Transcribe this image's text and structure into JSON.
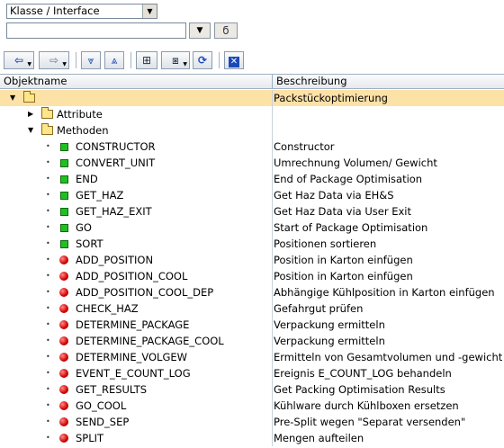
{
  "toolbar": {
    "type_select": "Klasse / Interface",
    "object_value": "",
    "icons": [
      "back-icon",
      "forward-icon",
      "collapse-all-icon",
      "expand-all-icon",
      "hierarchy-icon",
      "display-object-icon",
      "refresh-icon",
      "close-icon"
    ]
  },
  "table": {
    "col_name": "Objektname",
    "col_desc": "Beschreibung"
  },
  "tree": {
    "root": {
      "name": "",
      "desc": "Packstückoptimierung"
    },
    "attribute": {
      "name": "Attribute",
      "desc": ""
    },
    "methoden": {
      "name": "Methoden",
      "desc": ""
    },
    "methods": [
      {
        "name": "CONSTRUCTOR",
        "desc": "Constructor",
        "status": "green"
      },
      {
        "name": "CONVERT_UNIT",
        "desc": "Umrechnung Volumen/ Gewicht",
        "status": "green"
      },
      {
        "name": "END",
        "desc": "End of  Package Optimisation",
        "status": "green"
      },
      {
        "name": "GET_HAZ",
        "desc": "Get Haz Data via EH&S",
        "status": "green"
      },
      {
        "name": "GET_HAZ_EXIT",
        "desc": "Get Haz Data via User Exit",
        "status": "green"
      },
      {
        "name": "GO",
        "desc": "Start of Package Optimisation",
        "status": "green"
      },
      {
        "name": "SORT",
        "desc": "Positionen sortieren",
        "status": "green"
      },
      {
        "name": "ADD_POSITION",
        "desc": "Position in Karton einfügen",
        "status": "red"
      },
      {
        "name": "ADD_POSITION_COOL",
        "desc": "Position in Karton einfügen",
        "status": "red"
      },
      {
        "name": "ADD_POSITION_COOL_DEP",
        "desc": "Abhängige Kühlposition in Karton einfügen",
        "status": "red"
      },
      {
        "name": "CHECK_HAZ",
        "desc": "Gefahrgut prüfen",
        "status": "red"
      },
      {
        "name": "DETERMINE_PACKAGE",
        "desc": "Verpackung ermitteln",
        "status": "red"
      },
      {
        "name": "DETERMINE_PACKAGE_COOL",
        "desc": "Verpackung ermitteln",
        "status": "red"
      },
      {
        "name": "DETERMINE_VOLGEW",
        "desc": "Ermitteln von Gesamtvolumen und -gewicht",
        "status": "red"
      },
      {
        "name": "EVENT_E_COUNT_LOG",
        "desc": "Ereignis E_COUNT_LOG behandeln",
        "status": "red"
      },
      {
        "name": "GET_RESULTS",
        "desc": "Get Packing Optimisation Results",
        "status": "red"
      },
      {
        "name": "GO_COOL",
        "desc": "Kühlware durch Kühlboxen ersetzen",
        "status": "red"
      },
      {
        "name": "SEND_SEP",
        "desc": "Pre-Split wegen \"Separat versenden\"",
        "status": "red"
      },
      {
        "name": "SPLIT",
        "desc": "Mengen aufteilen",
        "status": "red"
      }
    ]
  }
}
